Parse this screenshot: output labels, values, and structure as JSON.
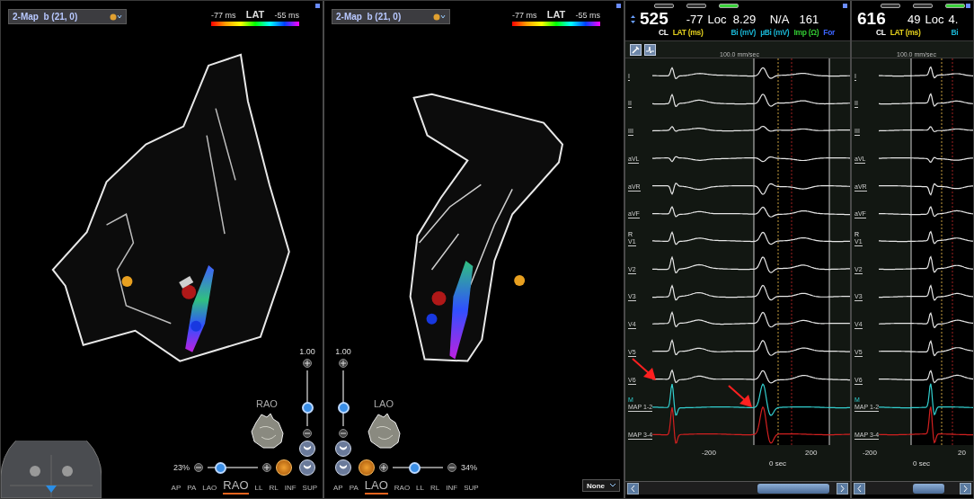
{
  "map_panels": [
    {
      "map_selector": "2-Map  b (21, 0)",
      "lat_scale": {
        "min": "-77 ms",
        "title": "LAT",
        "max": "-55 ms"
      },
      "opacity": {
        "value": "1.00",
        "level": 0.33
      },
      "orientation": "RAO",
      "transparency": {
        "value": "23%",
        "level": 0.25
      },
      "views": [
        {
          "label": "AP",
          "selected": false
        },
        {
          "label": "PA",
          "selected": false
        },
        {
          "label": "LAO",
          "selected": false
        },
        {
          "label": "RAO",
          "selected": true
        },
        {
          "label": "LL",
          "selected": false
        },
        {
          "label": "RL",
          "selected": false
        },
        {
          "label": "INF",
          "selected": false
        },
        {
          "label": "SUP",
          "selected": false
        }
      ]
    },
    {
      "map_selector": "2-Map  b (21, 0)",
      "lat_scale": {
        "min": "-77 ms",
        "title": "LAT",
        "max": "-55 ms"
      },
      "opacity": {
        "value": "1.00",
        "level": 0.33
      },
      "orientation": "LAO",
      "transparency": {
        "value": "34%",
        "level": 0.42
      },
      "display_filter": "None",
      "views": [
        {
          "label": "AP",
          "selected": false
        },
        {
          "label": "PA",
          "selected": false
        },
        {
          "label": "LAO",
          "selected": true
        },
        {
          "label": "RAO",
          "selected": false
        },
        {
          "label": "LL",
          "selected": false
        },
        {
          "label": "RL",
          "selected": false
        },
        {
          "label": "INF",
          "selected": false
        },
        {
          "label": "SUP",
          "selected": false
        }
      ]
    }
  ],
  "ecg_panels": [
    {
      "indicators": [
        {
          "on": false
        },
        {
          "on": false
        },
        {
          "on": true
        }
      ],
      "readouts": [
        {
          "value": "525",
          "label": "CL",
          "color": "#ffffff"
        },
        {
          "value": "-77",
          "label": "LAT (ms)",
          "color": "#e6d21e"
        },
        {
          "value": "Loc"
        },
        {
          "value": "8.29",
          "label": "Bi (mV)",
          "color": "#19b4d2"
        },
        {
          "value": "N/A",
          "label": "µBi (mV)",
          "color": "#19b4d2"
        },
        {
          "value": "161",
          "label": "Imp (Ω)",
          "color": "#32c832"
        },
        {
          "label": "For",
          "color": "#3c64ff"
        }
      ],
      "speed": "100.0 mm/sec",
      "leads": [
        {
          "label": "I",
          "color": "#e6e6e6"
        },
        {
          "label": "II",
          "color": "#e6e6e6"
        },
        {
          "label": "III",
          "color": "#e6e6e6"
        },
        {
          "label": "aVL",
          "color": "#e6e6e6"
        },
        {
          "label": "aVR",
          "color": "#e6e6e6"
        },
        {
          "label": "aVF",
          "color": "#e6e6e6"
        },
        {
          "label": "V1",
          "marker": "R",
          "color": "#e6e6e6"
        },
        {
          "label": "V2",
          "color": "#e6e6e6"
        },
        {
          "label": "V3",
          "color": "#e6e6e6"
        },
        {
          "label": "V4",
          "color": "#e6e6e6"
        },
        {
          "label": "V5",
          "color": "#e6e6e6"
        },
        {
          "label": "V6",
          "color": "#e6e6e6"
        },
        {
          "label": "MAP 1-2",
          "marker": "M",
          "color": "#33d0d0"
        },
        {
          "label": "MAP 3-4",
          "color": "#d22020"
        }
      ],
      "scale": [
        "-200",
        "200"
      ],
      "zero_label": "0 sec"
    },
    {
      "indicators": [
        {
          "on": false
        },
        {
          "on": false
        },
        {
          "on": true
        }
      ],
      "readouts": [
        {
          "value": "616",
          "label": "CL",
          "color": "#ffffff"
        },
        {
          "value": "49",
          "label": "LAT (ms)",
          "color": "#e6d21e"
        },
        {
          "value": "Loc"
        },
        {
          "value": "4.",
          "label": "Bi",
          "color": "#19b4d2"
        }
      ],
      "speed": "100.0 mm/sec",
      "leads": [
        {
          "label": "I",
          "color": "#e6e6e6"
        },
        {
          "label": "II",
          "color": "#e6e6e6"
        },
        {
          "label": "III",
          "color": "#e6e6e6"
        },
        {
          "label": "aVL",
          "color": "#e6e6e6"
        },
        {
          "label": "aVR",
          "color": "#e6e6e6"
        },
        {
          "label": "aVF",
          "color": "#e6e6e6"
        },
        {
          "label": "V1",
          "marker": "R",
          "color": "#e6e6e6"
        },
        {
          "label": "V2",
          "color": "#e6e6e6"
        },
        {
          "label": "V3",
          "color": "#e6e6e6"
        },
        {
          "label": "V4",
          "color": "#e6e6e6"
        },
        {
          "label": "V5",
          "color": "#e6e6e6"
        },
        {
          "label": "V6",
          "color": "#e6e6e6"
        },
        {
          "label": "MAP 1-2",
          "marker": "M",
          "color": "#33d0d0"
        },
        {
          "label": "MAP 3-4",
          "color": "#d22020"
        }
      ],
      "scale": [
        "-200",
        "20"
      ],
      "zero_label": "0 sec"
    }
  ]
}
